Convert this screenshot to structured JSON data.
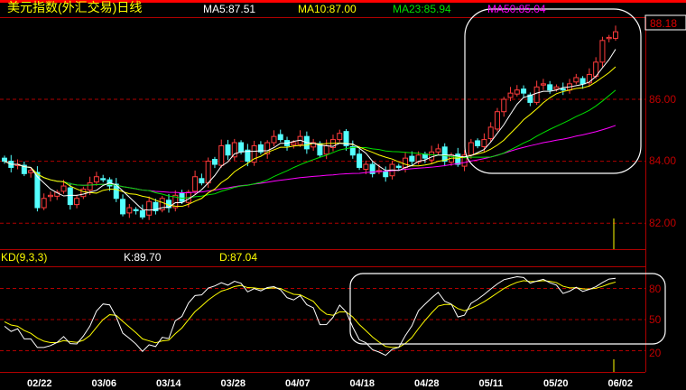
{
  "header": {
    "title": "美元指数(外汇交易)日线",
    "ma5": "MA5:87.51",
    "ma10": "MA10:87.00",
    "ma23": "MA23:85.94",
    "ma50": "MA50:85.04"
  },
  "price_axis": {
    "current": "88.18",
    "ticks": [
      "86.00",
      "84.00",
      "82.00"
    ]
  },
  "kd": {
    "label": "KD(9,3,3)",
    "k": "K:89.70",
    "d": "D:87.04",
    "ticks": [
      "80",
      "50",
      "20"
    ]
  },
  "dates": [
    "02/22",
    "03/06",
    "03/14",
    "03/28",
    "04/07",
    "04/18",
    "04/28",
    "05/11",
    "05/20",
    "06/02"
  ],
  "colors": {
    "up": "#ff3c3c",
    "down": "#54ffff",
    "ma5": "#ffffff",
    "ma10": "#ffff00",
    "ma23": "#00e000",
    "ma50": "#ff00ff",
    "axis": "#b00000"
  },
  "chart_data": {
    "type": "candlestick",
    "closes": [
      84.0,
      83.8,
      83.9,
      83.6,
      83.7,
      82.5,
      82.8,
      82.9,
      83.0,
      83.2,
      82.6,
      82.8,
      83.1,
      83.3,
      83.5,
      83.4,
      83.2,
      82.8,
      82.3,
      82.5,
      82.4,
      82.2,
      82.7,
      82.4,
      82.8,
      82.5,
      82.9,
      82.7,
      83.0,
      83.5,
      83.3,
      84.0,
      83.9,
      84.5,
      84.2,
      84.6,
      84.3,
      84.0,
      84.5,
      84.3,
      84.6,
      84.8,
      84.7,
      84.5,
      84.6,
      84.8,
      84.4,
      84.6,
      84.2,
      84.5,
      84.7,
      84.9,
      84.5,
      84.2,
      83.8,
      83.9,
      83.6,
      83.7,
      83.5,
      83.9,
      83.8,
      84.1,
      84.0,
      84.2,
      84.1,
      84.3,
      84.4,
      84.0,
      84.2,
      83.9,
      84.2,
      84.6,
      84.5,
      84.7,
      85.1,
      85.6,
      86.0,
      86.2,
      86.3,
      86.2,
      85.9,
      86.4,
      86.5,
      86.3,
      86.4,
      86.3,
      86.5,
      86.7,
      86.5,
      86.8,
      87.2,
      87.9,
      88.0,
      88.18
    ],
    "ylim": [
      81.0,
      89.0
    ],
    "kd_ylim": [
      0,
      100
    ]
  }
}
